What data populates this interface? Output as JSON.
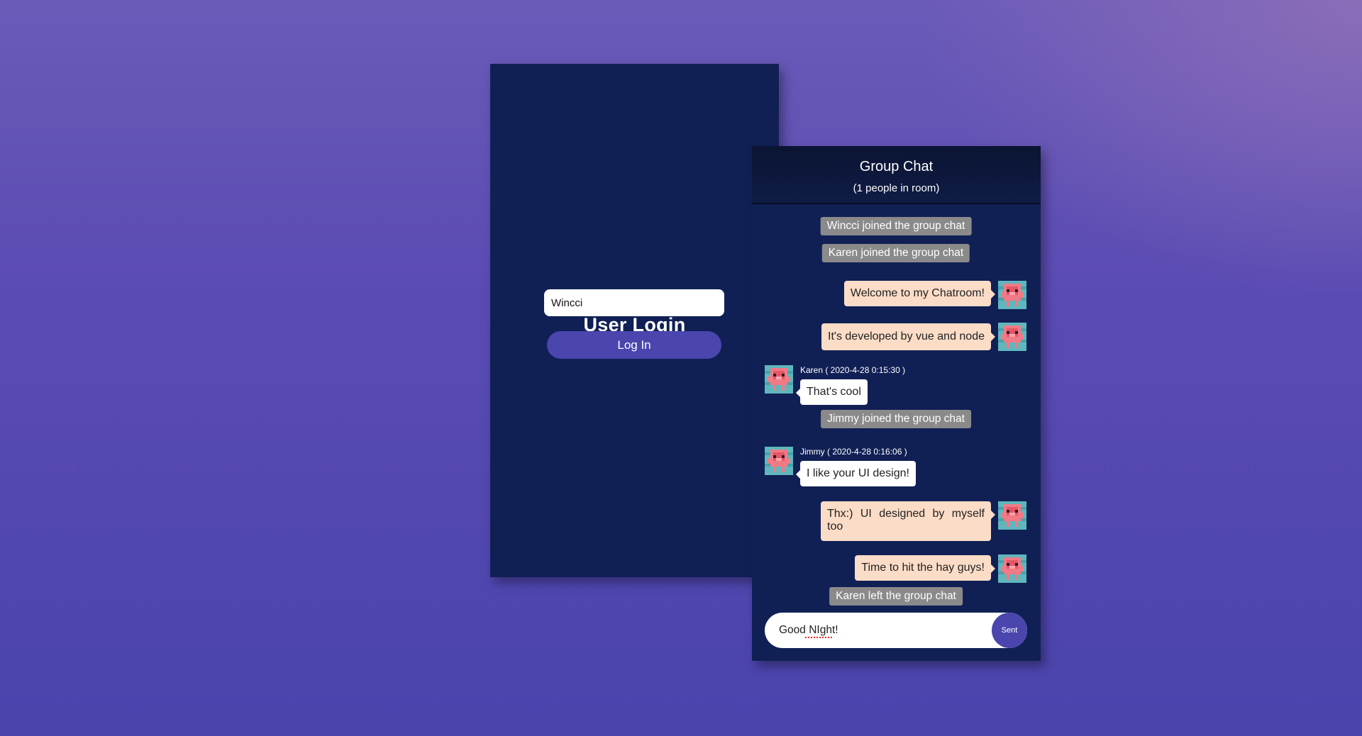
{
  "login": {
    "title": "User Login",
    "username_value": "Wincci",
    "login_button": "Log In"
  },
  "chat": {
    "title": "Group Chat",
    "subtitle": "(1 people in room)",
    "messages": [
      {
        "kind": "system",
        "text": "Wincci joined the group chat"
      },
      {
        "kind": "system",
        "text": "Karen joined the group chat"
      },
      {
        "kind": "self",
        "text": "Welcome to my Chatroom!"
      },
      {
        "kind": "self",
        "text": "It's developed by vue and node"
      },
      {
        "kind": "other",
        "meta": "Karen ( 2020-4-28 0:15:30 )",
        "text": "That's cool"
      },
      {
        "kind": "system",
        "text": "Jimmy joined the group chat"
      },
      {
        "kind": "other",
        "meta": "Jimmy ( 2020-4-28 0:16:06 )",
        "text": "I like your UI design!"
      },
      {
        "kind": "self",
        "text": "Thx:) UI designed by myself too"
      },
      {
        "kind": "self",
        "text": "Time to hit the hay guys!"
      },
      {
        "kind": "system",
        "text": "Karen left the group chat"
      }
    ],
    "input_value": "Good NIght!",
    "send_button": "Sent"
  },
  "colors": {
    "panel_bg": "#102055",
    "accent": "#4a46ad",
    "self_bubble": "#fbdcc6",
    "system_bubble": "#8a8a8a"
  },
  "icons": {
    "avatar": "pink-robot-avatar-icon"
  }
}
